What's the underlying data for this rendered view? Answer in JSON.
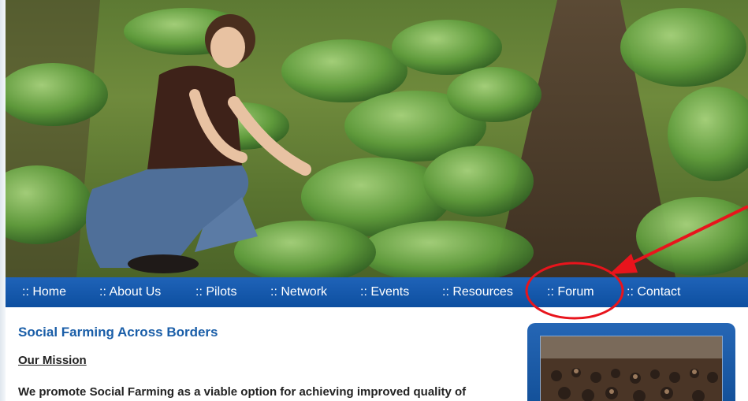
{
  "nav": {
    "items": [
      {
        "label": ":: Home"
      },
      {
        "label": ":: About Us"
      },
      {
        "label": ":: Pilots"
      },
      {
        "label": ":: Network"
      },
      {
        "label": ":: Events"
      },
      {
        "label": ":: Resources"
      },
      {
        "label": ":: Forum"
      },
      {
        "label": ":: Contact"
      }
    ]
  },
  "main": {
    "title": "Social Farming Across Borders",
    "section_heading": "Our Mission",
    "intro_text": "We promote Social Farming as a viable option for achieving improved quality of"
  },
  "annotation": {
    "color": "#e8141c",
    "highlighted_item": ":: Forum"
  },
  "colors": {
    "nav_bar": "#0d4fa0",
    "title": "#1a5ea8",
    "sidebar_box": "#1b58a2"
  }
}
